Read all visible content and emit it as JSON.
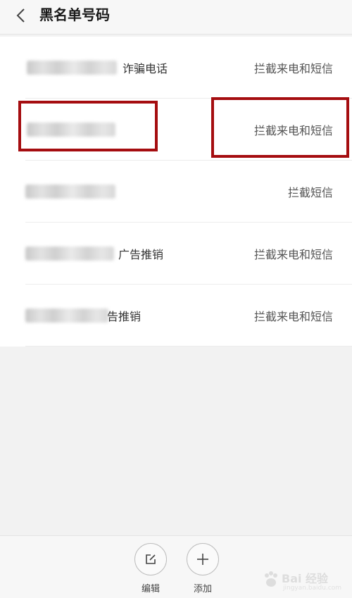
{
  "header": {
    "title": "黑名单号码"
  },
  "list": {
    "rows": [
      {
        "label": "诈骗电话",
        "mode": "拦截来电和短信"
      },
      {
        "label": "",
        "mode": "拦截来电和短信"
      },
      {
        "label": "",
        "mode": "拦截短信"
      },
      {
        "label": "广告推销",
        "mode": "拦截来电和短信"
      },
      {
        "label": "告推销",
        "mode": "拦截来电和短信"
      }
    ]
  },
  "toolbar": {
    "edit_label": "编辑",
    "add_label": "添加"
  },
  "colors": {
    "highlight": "#a50d10",
    "background": "#f2f2f2"
  },
  "icons": {
    "back": "chevron-left-icon",
    "edit": "edit-icon",
    "add": "plus-icon",
    "watermark": "baidu-paw-icon"
  }
}
